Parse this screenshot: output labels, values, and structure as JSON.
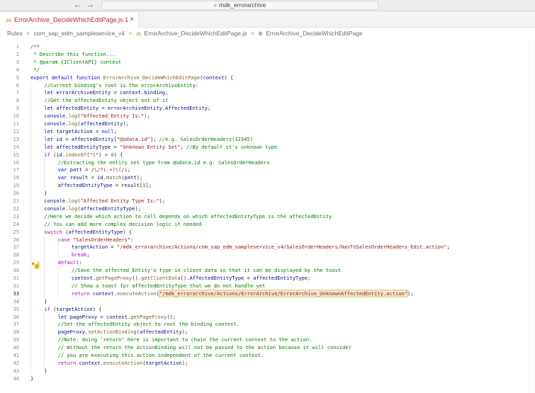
{
  "titlebar": {
    "back": "←",
    "forward": "→",
    "search_text": "mdk_errorarchive"
  },
  "tab": {
    "badge": "JS",
    "label": "ErrorArchive_DecideWhichEditPage.js 1",
    "close": "×"
  },
  "breadcrumb": {
    "items": [
      "Rules",
      "com_sap_edm_sampleservice_v4",
      "ErrorArchive_DecideWhichEditPage.js",
      "ErrorArchive_DecideWhichEditPage"
    ],
    "separator": ">",
    "badge": "JS"
  },
  "editor": {
    "current_line": 33,
    "lines": [
      {
        "n": "1",
        "indent": 0,
        "tokens": [
          [
            "c-com",
            "/**"
          ]
        ]
      },
      {
        "n": "2",
        "indent": 0,
        "tokens": [
          [
            "c-com",
            " * Describe this function..."
          ]
        ]
      },
      {
        "n": "3",
        "indent": 0,
        "tokens": [
          [
            "c-com",
            " * @param {IClientAPI} context"
          ]
        ]
      },
      {
        "n": "4",
        "indent": 0,
        "tokens": [
          [
            "c-com",
            " */"
          ]
        ]
      },
      {
        "n": "5",
        "indent": 0,
        "tokens": [
          [
            "c-kw",
            "export default "
          ],
          [
            "c-kw",
            "function "
          ],
          [
            "c-fn",
            "ErrorArchive_DecideWhichEditPage"
          ],
          [
            "",
            "("
          ],
          [
            "c-var",
            "context"
          ],
          [
            "",
            ") {"
          ]
        ]
      },
      {
        "n": "6",
        "indent": 1,
        "tokens": [
          [
            "c-com",
            "//Current binding's root is the errorArchiveEntity:"
          ]
        ]
      },
      {
        "n": "7",
        "indent": 1,
        "tokens": [
          [
            "c-kw",
            "let "
          ],
          [
            "c-var",
            "errorArchiveEntity"
          ],
          [
            "",
            " = "
          ],
          [
            "c-var",
            "context"
          ],
          [
            "",
            "."
          ],
          [
            "c-var",
            "binding"
          ],
          [
            "",
            ";"
          ]
        ]
      },
      {
        "n": "8",
        "indent": 1,
        "tokens": [
          [
            "c-com",
            "//Get the affectedEntity object out of it"
          ]
        ]
      },
      {
        "n": "9",
        "indent": 1,
        "tokens": [
          [
            "c-kw",
            "let "
          ],
          [
            "c-var",
            "affectedEntity"
          ],
          [
            "",
            " = "
          ],
          [
            "c-var",
            "errorArchiveEntity"
          ],
          [
            "",
            "."
          ],
          [
            "c-var",
            "AffectedEntity"
          ],
          [
            "",
            ";"
          ]
        ]
      },
      {
        "n": "10",
        "indent": 1,
        "tokens": [
          [
            "c-var",
            "console"
          ],
          [
            "",
            "."
          ],
          [
            "c-fn",
            "log"
          ],
          [
            "",
            "("
          ],
          [
            "c-str",
            "\"Affected Entity Is:\""
          ],
          [
            "",
            ");"
          ]
        ]
      },
      {
        "n": "11",
        "indent": 1,
        "tokens": [
          [
            "c-var",
            "console"
          ],
          [
            "",
            "."
          ],
          [
            "c-fn",
            "log"
          ],
          [
            "",
            "("
          ],
          [
            "c-var",
            "affectedEntity"
          ],
          [
            "",
            ");"
          ]
        ]
      },
      {
        "n": "12",
        "indent": 1,
        "tokens": [
          [
            "c-kw",
            "let "
          ],
          [
            "c-var",
            "targetAction"
          ],
          [
            "",
            " = "
          ],
          [
            "c-kw",
            "null"
          ],
          [
            "",
            ";"
          ]
        ]
      },
      {
        "n": "13",
        "indent": 1,
        "tokens": [
          [
            "c-kw",
            "let "
          ],
          [
            "c-var",
            "id"
          ],
          [
            "",
            " = "
          ],
          [
            "c-var",
            "affectedEntity"
          ],
          [
            "",
            "["
          ],
          [
            "c-str",
            "\"@odata.id\""
          ],
          [
            "",
            "]; "
          ],
          [
            "c-com",
            "//e.g. SalesOrderHeaders(12345)"
          ]
        ]
      },
      {
        "n": "14",
        "indent": 1,
        "tokens": [
          [
            "c-kw",
            "let "
          ],
          [
            "c-var",
            "affectedEntityType"
          ],
          [
            "",
            " = "
          ],
          [
            "c-str",
            "\"Unknown Entity Set\""
          ],
          [
            "",
            "; "
          ],
          [
            "c-com",
            "//By default it's unknown type"
          ]
        ]
      },
      {
        "n": "15",
        "indent": 1,
        "tokens": [
          [
            "c-ctl",
            "if "
          ],
          [
            "",
            "("
          ],
          [
            "c-var",
            "id"
          ],
          [
            "",
            "."
          ],
          [
            "c-fn",
            "indexOf"
          ],
          [
            "",
            "("
          ],
          [
            "c-str",
            "\"(\""
          ],
          [
            "",
            ") > "
          ],
          [
            "c-num",
            "0"
          ],
          [
            "",
            ") {"
          ]
        ]
      },
      {
        "n": "16",
        "indent": 2,
        "tokens": [
          [
            "c-com",
            "//Extracting the entity set type from @odata.id e.g. SalesOrderHeaders"
          ]
        ]
      },
      {
        "n": "17",
        "indent": 2,
        "tokens": [
          [
            "c-kw",
            "var "
          ],
          [
            "c-var",
            "patt"
          ],
          [
            "",
            " = "
          ],
          [
            "c-str",
            "/\\/?(.+)\\(/i"
          ],
          [
            "",
            ";"
          ]
        ]
      },
      {
        "n": "18",
        "indent": 2,
        "tokens": [
          [
            "c-kw",
            "var "
          ],
          [
            "c-var",
            "result"
          ],
          [
            "",
            " = "
          ],
          [
            "c-var",
            "id"
          ],
          [
            "",
            "."
          ],
          [
            "c-fn",
            "match"
          ],
          [
            "",
            "("
          ],
          [
            "c-var",
            "patt"
          ],
          [
            "",
            ");"
          ]
        ]
      },
      {
        "n": "19",
        "indent": 2,
        "tokens": [
          [
            "c-var",
            "affectedEntityType"
          ],
          [
            "",
            " = "
          ],
          [
            "c-var",
            "result"
          ],
          [
            "",
            "["
          ],
          [
            "c-num",
            "1"
          ],
          [
            "",
            "];"
          ]
        ]
      },
      {
        "n": "20",
        "indent": 1,
        "tokens": [
          [
            "",
            "}"
          ]
        ]
      },
      {
        "n": "21",
        "indent": 1,
        "tokens": [
          [
            "c-var",
            "console"
          ],
          [
            "",
            "."
          ],
          [
            "c-fn",
            "log"
          ],
          [
            "",
            "("
          ],
          [
            "c-str",
            "\"Affected Entity Type Is:\""
          ],
          [
            "",
            ");"
          ]
        ]
      },
      {
        "n": "22",
        "indent": 1,
        "tokens": [
          [
            "c-var",
            "console"
          ],
          [
            "",
            "."
          ],
          [
            "c-fn",
            "log"
          ],
          [
            "",
            "("
          ],
          [
            "c-var",
            "affectedEntityType"
          ],
          [
            "",
            ");"
          ]
        ]
      },
      {
        "n": "23",
        "indent": 1,
        "tokens": [
          [
            "c-com",
            "//Here we decide which action to call depends on which affectedEntityType is the affectedEntity"
          ]
        ]
      },
      {
        "n": "24",
        "indent": 1,
        "tokens": [
          [
            "c-com",
            "// You can add more complex decision logic if needed"
          ]
        ]
      },
      {
        "n": "25",
        "indent": 1,
        "tokens": [
          [
            "c-ctl",
            "switch "
          ],
          [
            "",
            "("
          ],
          [
            "c-var",
            "affectedEntityType"
          ],
          [
            "",
            ") {"
          ]
        ]
      },
      {
        "n": "26",
        "indent": 2,
        "tokens": [
          [
            "c-ctl",
            "case "
          ],
          [
            "c-str",
            "\"SalesOrderHeaders\""
          ],
          [
            "",
            ":"
          ]
        ]
      },
      {
        "n": "27",
        "indent": 3,
        "tokens": [
          [
            "c-var",
            "targetAction"
          ],
          [
            "",
            " = "
          ],
          [
            "c-str",
            "\"/mdk_errorarchive/Actions/com_sap_edm_sampleservice_v4/SalesOrderHeaders/NavToSalesOrderHeaders_Edit.action\""
          ],
          [
            "",
            ";"
          ]
        ]
      },
      {
        "n": "28",
        "indent": 3,
        "tokens": [
          [
            "c-ctl",
            "break"
          ],
          [
            "",
            ";"
          ]
        ]
      },
      {
        "n": "29",
        "indent": 2,
        "tokens": [
          [
            "c-ctl",
            "default"
          ],
          [
            "",
            ":"
          ]
        ]
      },
      {
        "n": "30",
        "indent": 3,
        "tokens": [
          [
            "c-com",
            "//Save the affected Entity's type in client data so that it can be displayed by the toast"
          ]
        ]
      },
      {
        "n": "31",
        "indent": 3,
        "tokens": [
          [
            "c-var",
            "context"
          ],
          [
            "",
            "."
          ],
          [
            "c-fn",
            "getPageProxy"
          ],
          [
            "",
            "()."
          ],
          [
            "c-fn",
            "getClientData"
          ],
          [
            "",
            "()."
          ],
          [
            "c-var",
            "AffectedEntityType"
          ],
          [
            "",
            " = "
          ],
          [
            "c-var",
            "affectedEntityType"
          ],
          [
            "",
            ";"
          ]
        ]
      },
      {
        "n": "32",
        "indent": 3,
        "tokens": [
          [
            "c-com",
            "// Show a toast for affectedEntityType that we do not handle yet"
          ]
        ]
      },
      {
        "n": "33",
        "indent": 3,
        "tokens": [
          [
            "c-ctl",
            "return "
          ],
          [
            "c-var",
            "context"
          ],
          [
            "",
            "."
          ],
          [
            "c-fn",
            "executeAction"
          ],
          [
            "",
            "("
          ],
          [
            "c-str hl",
            "\"/mdk_errorarchive/Actions/ErrorArchive/ErrorArchive_UnknownAffectedEntity.action\""
          ],
          [
            "",
            ");"
          ]
        ]
      },
      {
        "n": "34",
        "indent": 1,
        "tokens": [
          [
            "",
            "}"
          ]
        ]
      },
      {
        "n": "35",
        "indent": 1,
        "tokens": [
          [
            "c-ctl",
            "if "
          ],
          [
            "",
            "("
          ],
          [
            "c-var",
            "targetAction"
          ],
          [
            "",
            ") {"
          ]
        ]
      },
      {
        "n": "36",
        "indent": 2,
        "tokens": [
          [
            "c-kw",
            "let "
          ],
          [
            "c-var",
            "pageProxy"
          ],
          [
            "",
            " = "
          ],
          [
            "c-var",
            "context"
          ],
          [
            "",
            "."
          ],
          [
            "c-fn",
            "getPageProxy"
          ],
          [
            "",
            "();"
          ]
        ]
      },
      {
        "n": "37",
        "indent": 2,
        "tokens": [
          [
            "c-com",
            "//Set the affectedEntity object to root the binding context."
          ]
        ]
      },
      {
        "n": "38",
        "indent": 2,
        "tokens": [
          [
            "c-var",
            "pageProxy"
          ],
          [
            "",
            "."
          ],
          [
            "c-fn",
            "setActionBinding"
          ],
          [
            "",
            "("
          ],
          [
            "c-var",
            "affectedEntity"
          ],
          [
            "",
            ");"
          ]
        ]
      },
      {
        "n": "39",
        "indent": 2,
        "tokens": [
          [
            "c-com",
            "//Note: doing 'return' here is important to chain the current context to the action."
          ]
        ]
      },
      {
        "n": "40",
        "indent": 2,
        "tokens": [
          [
            "c-com",
            "// Without the return the ActionBinding will not be passed to the action because it will consider"
          ]
        ]
      },
      {
        "n": "41",
        "indent": 2,
        "tokens": [
          [
            "c-com",
            "// you are executing this action independent of the current context."
          ]
        ]
      },
      {
        "n": "42",
        "indent": 2,
        "tokens": [
          [
            "c-ctl",
            "return "
          ],
          [
            "c-var",
            "context"
          ],
          [
            "",
            "."
          ],
          [
            "c-fn",
            "executeAction"
          ],
          [
            "",
            "("
          ],
          [
            "c-var",
            "targetAction"
          ],
          [
            "",
            ");"
          ]
        ]
      },
      {
        "n": "43",
        "indent": 1,
        "tokens": [
          [
            "",
            "}"
          ]
        ]
      },
      {
        "n": "44",
        "indent": 0,
        "tokens": [
          [
            "",
            "}"
          ]
        ]
      }
    ]
  }
}
